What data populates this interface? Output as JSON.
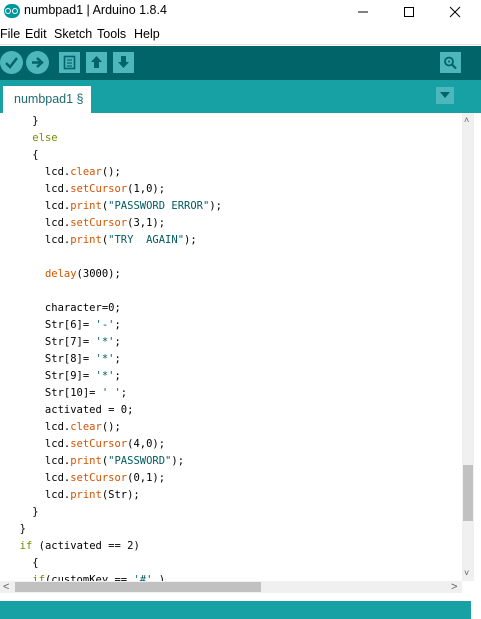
{
  "window": {
    "title": "numbpad1 | Arduino 1.8.4",
    "controls": {
      "minimize": "minimize",
      "maximize": "maximize",
      "close": "close"
    }
  },
  "menu": {
    "items": [
      {
        "label": "File"
      },
      {
        "label": "Edit"
      },
      {
        "label": "Sketch"
      },
      {
        "label": "Tools"
      },
      {
        "label": "Help"
      }
    ]
  },
  "toolbar": {
    "buttons": [
      {
        "icon": "verify-icon"
      },
      {
        "icon": "upload-icon"
      },
      {
        "icon": "new-icon"
      },
      {
        "icon": "open-icon"
      },
      {
        "icon": "save-icon"
      }
    ],
    "serial_monitor_icon": "serial-monitor-icon"
  },
  "tabs": {
    "active": {
      "label": "numbpad1 §"
    },
    "menu_icon": "tab-menu-icon"
  },
  "colors": {
    "toolbar": "#006468",
    "tabbar": "#17a1a5",
    "button": "#4db7bb",
    "keyword": "#728e00",
    "function": "#d35400",
    "string": "#005c5f"
  },
  "code": {
    "lines": [
      [
        {
          "t": "    }"
        }
      ],
      [
        {
          "t": "    "
        },
        {
          "t": "else",
          "c": "kw"
        }
      ],
      [
        {
          "t": "    {"
        }
      ],
      [
        {
          "t": "      lcd."
        },
        {
          "t": "clear",
          "c": "fn"
        },
        {
          "t": "();"
        }
      ],
      [
        {
          "t": "      lcd."
        },
        {
          "t": "setCursor",
          "c": "fn"
        },
        {
          "t": "(1,0);"
        }
      ],
      [
        {
          "t": "      lcd."
        },
        {
          "t": "print",
          "c": "fn"
        },
        {
          "t": "("
        },
        {
          "t": "\"PASSWORD ERROR\"",
          "c": "str"
        },
        {
          "t": ");"
        }
      ],
      [
        {
          "t": "      lcd."
        },
        {
          "t": "setCursor",
          "c": "fn"
        },
        {
          "t": "(3,1);"
        }
      ],
      [
        {
          "t": "      lcd."
        },
        {
          "t": "print",
          "c": "fn"
        },
        {
          "t": "("
        },
        {
          "t": "\"TRY  AGAIN\"",
          "c": "str"
        },
        {
          "t": ");"
        }
      ],
      [
        {
          "t": ""
        }
      ],
      [
        {
          "t": "      "
        },
        {
          "t": "delay",
          "c": "fn"
        },
        {
          "t": "(3000);"
        }
      ],
      [
        {
          "t": ""
        }
      ],
      [
        {
          "t": "      character=0;"
        }
      ],
      [
        {
          "t": "      Str[6]= "
        },
        {
          "t": "'-'",
          "c": "str"
        },
        {
          "t": ";"
        }
      ],
      [
        {
          "t": "      Str[7]= "
        },
        {
          "t": "'*'",
          "c": "str"
        },
        {
          "t": ";"
        }
      ],
      [
        {
          "t": "      Str[8]= "
        },
        {
          "t": "'*'",
          "c": "str"
        },
        {
          "t": ";"
        }
      ],
      [
        {
          "t": "      Str[9]= "
        },
        {
          "t": "'*'",
          "c": "str"
        },
        {
          "t": ";"
        }
      ],
      [
        {
          "t": "      Str[10]= "
        },
        {
          "t": "' '",
          "c": "str"
        },
        {
          "t": ";"
        }
      ],
      [
        {
          "t": "      activated = 0;"
        }
      ],
      [
        {
          "t": "      lcd."
        },
        {
          "t": "clear",
          "c": "fn"
        },
        {
          "t": "();"
        }
      ],
      [
        {
          "t": "      lcd."
        },
        {
          "t": "setCursor",
          "c": "fn"
        },
        {
          "t": "(4,0);"
        }
      ],
      [
        {
          "t": "      lcd."
        },
        {
          "t": "print",
          "c": "fn"
        },
        {
          "t": "("
        },
        {
          "t": "\"PASSWORD\"",
          "c": "str"
        },
        {
          "t": ");"
        }
      ],
      [
        {
          "t": "      lcd."
        },
        {
          "t": "setCursor",
          "c": "fn"
        },
        {
          "t": "(0,1);"
        }
      ],
      [
        {
          "t": "      lcd."
        },
        {
          "t": "print",
          "c": "fn"
        },
        {
          "t": "(Str);"
        }
      ],
      [
        {
          "t": "    }"
        }
      ],
      [
        {
          "t": "  }"
        }
      ],
      [
        {
          "t": "  "
        },
        {
          "t": "if",
          "c": "kw"
        },
        {
          "t": " (activated == 2)"
        }
      ],
      [
        {
          "t": "    {"
        }
      ],
      [
        {
          "t": "    "
        },
        {
          "t": "if",
          "c": "kw"
        },
        {
          "t": "(customKey == "
        },
        {
          "t": "'#'",
          "c": "str"
        },
        {
          "t": " )"
        }
      ]
    ]
  },
  "scrollbars": {
    "vertical": {
      "up": "˄",
      "down": "˅"
    },
    "horizontal": {
      "left": "<",
      "right": ">"
    }
  }
}
